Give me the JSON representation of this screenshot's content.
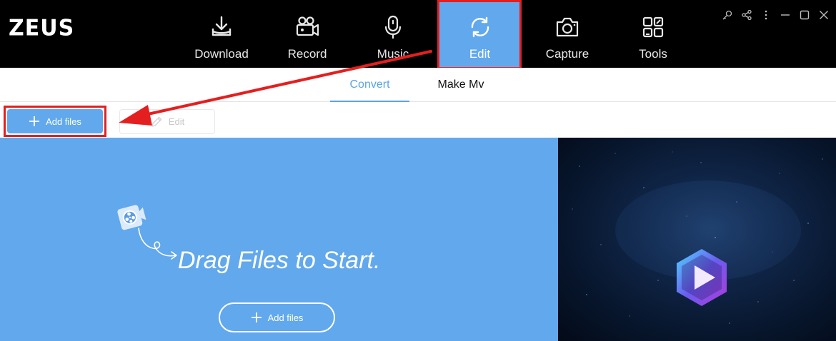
{
  "app": {
    "logo": "ZEUS"
  },
  "nav": {
    "items": [
      {
        "label": "Download",
        "icon": "download-icon"
      },
      {
        "label": "Record",
        "icon": "video-camera-icon"
      },
      {
        "label": "Music",
        "icon": "microphone-icon"
      },
      {
        "label": "Edit",
        "icon": "convert-cycle-icon"
      },
      {
        "label": "Capture",
        "icon": "camera-icon"
      },
      {
        "label": "Tools",
        "icon": "tools-grid-icon"
      }
    ],
    "active": "Edit"
  },
  "window_controls": [
    "key-icon",
    "share-icon",
    "more-icon",
    "minimize-icon",
    "maximize-icon",
    "close-icon"
  ],
  "subtabs": {
    "convert": "Convert",
    "make_mv": "Make Mv",
    "active": "Convert"
  },
  "toolbar": {
    "add_files_label": "Add files",
    "edit_label": "Edit"
  },
  "drop_area": {
    "prompt": "Drag Files to Start.",
    "add_files_label": "Add files"
  },
  "colors": {
    "accent": "#62a8ec",
    "topbar": "#000000",
    "annotation": "#e41f1f"
  }
}
